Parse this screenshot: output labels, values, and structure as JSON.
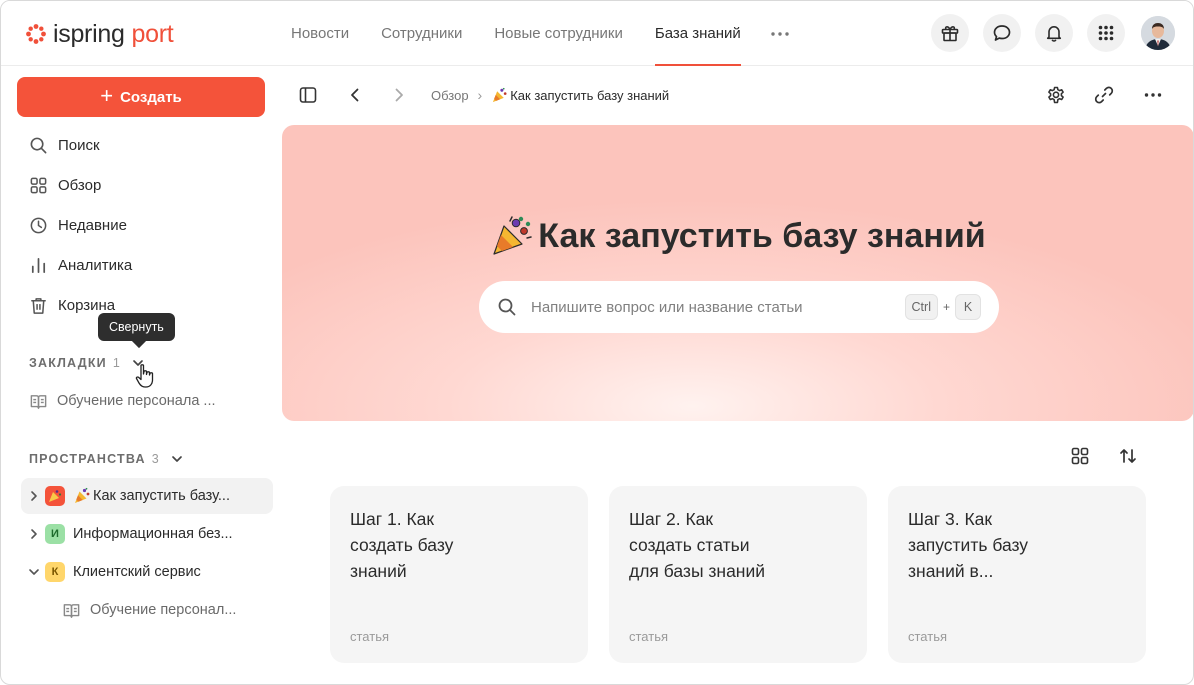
{
  "app": {
    "logo_word1": "ispring",
    "logo_word2": "port",
    "brand_color": "#f0503a"
  },
  "nav": {
    "tabs": [
      {
        "label": "Новости",
        "active": false
      },
      {
        "label": "Сотрудники",
        "active": false
      },
      {
        "label": "Новые сотрудники",
        "active": false
      },
      {
        "label": "База знаний",
        "active": true
      }
    ],
    "more_icon": "ellipsis-icon"
  },
  "header_icons": [
    "gift-icon",
    "chat-icon",
    "bell-icon",
    "apps-grid-icon",
    "avatar"
  ],
  "sidebar": {
    "create_label": "Создать",
    "items": [
      {
        "label": "Поиск",
        "icon": "search-icon"
      },
      {
        "label": "Обзор",
        "icon": "overview-grid-icon"
      },
      {
        "label": "Недавние",
        "icon": "clock-icon"
      },
      {
        "label": "Аналитика",
        "icon": "analytics-icon"
      },
      {
        "label": "Корзина",
        "icon": "trash-icon"
      }
    ],
    "tooltip": "Свернуть",
    "bookmarks": {
      "title": "ЗАКЛАДКИ",
      "count": "1",
      "items": [
        {
          "label": "Обучение персонала ..."
        }
      ]
    },
    "spaces": {
      "title": "ПРОСТРАНСТВА",
      "count": "3",
      "items": [
        {
          "label": "Как запустить базу...",
          "badge": "",
          "expanded": false,
          "active": true
        },
        {
          "label": "Информационная без...",
          "badge": "И",
          "expanded": false,
          "active": false
        },
        {
          "label": "Клиентский сервис",
          "badge": "К",
          "expanded": true,
          "active": false
        }
      ],
      "sub_items": [
        {
          "label": "Обучение персонал..."
        }
      ]
    }
  },
  "toolbar": {
    "breadcrumb_root": "Обзор",
    "breadcrumb_current": "Как запустить базу знаний"
  },
  "hero": {
    "title": "Как запустить базу знаний",
    "search_placeholder": "Напишите вопрос или название статьи",
    "shortcut_key1": "Ctrl",
    "shortcut_plus": "+",
    "shortcut_key2": "K"
  },
  "cards": [
    {
      "title": "Шаг 1. Как создать базу знаний",
      "type": "статья"
    },
    {
      "title": "Шаг 2. Как создать статьи для базы знаний",
      "type": "статья"
    },
    {
      "title": "Шаг 3. Как запустить базу знаний в...",
      "type": "статья"
    }
  ]
}
